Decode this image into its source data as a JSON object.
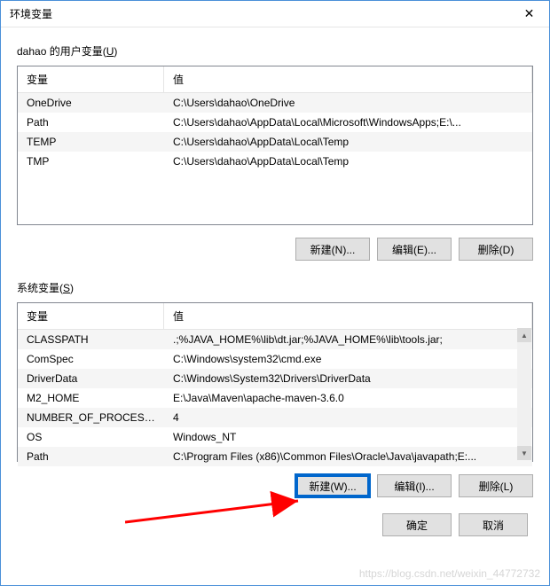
{
  "window": {
    "title": "环境变量",
    "close_label": "✕"
  },
  "user_section": {
    "label_prefix": "dahao 的用户变量(",
    "label_key": "U",
    "label_suffix": ")",
    "header": {
      "var": "变量",
      "val": "值"
    },
    "rows": [
      {
        "var": "OneDrive",
        "val": "C:\\Users\\dahao\\OneDrive"
      },
      {
        "var": "Path",
        "val": "C:\\Users\\dahao\\AppData\\Local\\Microsoft\\WindowsApps;E:\\..."
      },
      {
        "var": "TEMP",
        "val": "C:\\Users\\dahao\\AppData\\Local\\Temp"
      },
      {
        "var": "TMP",
        "val": "C:\\Users\\dahao\\AppData\\Local\\Temp"
      }
    ],
    "buttons": {
      "new": "新建(N)...",
      "edit": "编辑(E)...",
      "delete": "删除(D)"
    }
  },
  "sys_section": {
    "label_prefix": "系统变量(",
    "label_key": "S",
    "label_suffix": ")",
    "header": {
      "var": "变量",
      "val": "值"
    },
    "rows": [
      {
        "var": "CLASSPATH",
        "val": ".;%JAVA_HOME%\\lib\\dt.jar;%JAVA_HOME%\\lib\\tools.jar;"
      },
      {
        "var": "ComSpec",
        "val": "C:\\Windows\\system32\\cmd.exe"
      },
      {
        "var": "DriverData",
        "val": "C:\\Windows\\System32\\Drivers\\DriverData"
      },
      {
        "var": "M2_HOME",
        "val": "E:\\Java\\Maven\\apache-maven-3.6.0"
      },
      {
        "var": "NUMBER_OF_PROCESSORS",
        "val": "4"
      },
      {
        "var": "OS",
        "val": "Windows_NT"
      },
      {
        "var": "Path",
        "val": "C:\\Program Files (x86)\\Common Files\\Oracle\\Java\\javapath;E:..."
      }
    ],
    "buttons": {
      "new": "新建(W)...",
      "edit": "编辑(I)...",
      "delete": "删除(L)"
    }
  },
  "dialog_buttons": {
    "ok": "确定",
    "cancel": "取消"
  },
  "watermark": "https://blog.csdn.net/weixin_44772732",
  "scroll_arrows": {
    "up": "▲",
    "down": "▼"
  }
}
